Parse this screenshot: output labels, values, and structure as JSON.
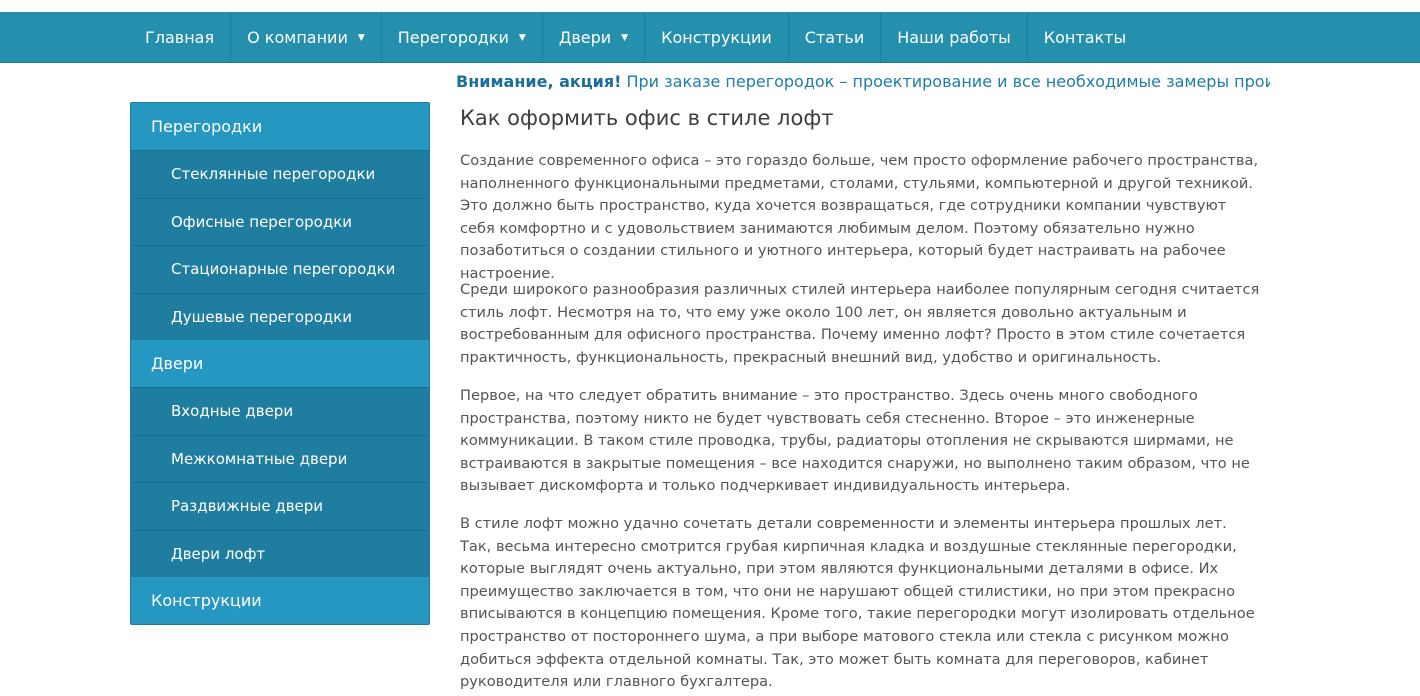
{
  "nav": {
    "items": [
      {
        "label": "Главная",
        "dropdown": false
      },
      {
        "label": "О компании",
        "dropdown": true
      },
      {
        "label": "Перегородки",
        "dropdown": true
      },
      {
        "label": "Двери",
        "dropdown": true
      },
      {
        "label": "Конструкции",
        "dropdown": false
      },
      {
        "label": "Статьи",
        "dropdown": false
      },
      {
        "label": "Наши работы",
        "dropdown": false
      },
      {
        "label": "Контакты",
        "dropdown": false
      }
    ],
    "caret": "▼"
  },
  "promo": {
    "label": "Внимание, акция!",
    "text": " При заказе перегородок – проектирование и все необходимые замеры производятся"
  },
  "sidebar": {
    "sections": [
      {
        "title": "Перегородки",
        "items": [
          "Стеклянные перегородки",
          "Офисные перегородки",
          "Стационарные перегородки",
          "Душевые перегородки"
        ]
      },
      {
        "title": "Двери",
        "items": [
          "Входные двери",
          "Межкомнатные двери",
          "Раздвижные двери",
          "Двери лофт"
        ]
      },
      {
        "title": "Конструкции",
        "items": []
      }
    ]
  },
  "article": {
    "title": "Как оформить офис в стиле лофт",
    "paragraphs": [
      "Создание современного офиса – это гораздо больше, чем просто оформление рабочего пространства, наполненного функциональными предметами, столами, стульями, компьютерной и другой техникой. Это должно быть пространство, куда хочется возвращаться, где сотрудники компании чувствуют себя комфортно и с удовольствием занимаются любимым делом. Поэтому обязательно нужно позаботиться о создании стильного и уютного интерьера, который будет настраивать на рабочее настроение.",
      "Среди широкого разнообразия различных стилей интерьера наиболее популярным сегодня считается стиль лофт. Несмотря на то, что ему уже около 100 лет, он является довольно актуальным и востребованным для офисного пространства. Почему именно лофт? Просто в этом стиле сочетается практичность, функциональность, прекрасный внешний вид, удобство и оригинальность.",
      "Первое, на что следует обратить внимание – это пространство. Здесь очень много свободного пространства, поэтому никто не будет чувствовать себя стесненно. Второе – это инженерные коммуникации. В таком стиле проводка, трубы, радиаторы отопления не скрываются ширмами, не встраиваются в закрытые помещения – все находится снаружи, но выполнено таким образом, что не вызывает дискомфорта и только подчеркивает индивидуальность интерьера.",
      "В стиле лофт можно удачно сочетать детали современности и элементы интерьера прошлых лет. Так, весьма интересно смотрится грубая кирпичная кладка и воздушные стеклянные перегородки, которые выглядят очень актуально, при этом являются функциональными деталями в офисе. Их преимущество заключается в том, что они не нарушают общей стилистики, но при этом прекрасно вписываются в концепцию помещения. Кроме того, такие перегородки могут изолировать отдельное пространство от постороннего шума, а при выборе матового стекла или стекла с рисунком можно добиться эффекта отдельной комнаты. Так, это может быть комната для переговоров, кабинет руководителя или главного бухгалтера."
    ]
  },
  "colors": {
    "nav_bg": "#2590ae",
    "sidebar_head": "#2597c0",
    "sidebar_sub": "#1f7ea0",
    "promo_text": "#1b7fa8",
    "body_text": "#555555"
  }
}
